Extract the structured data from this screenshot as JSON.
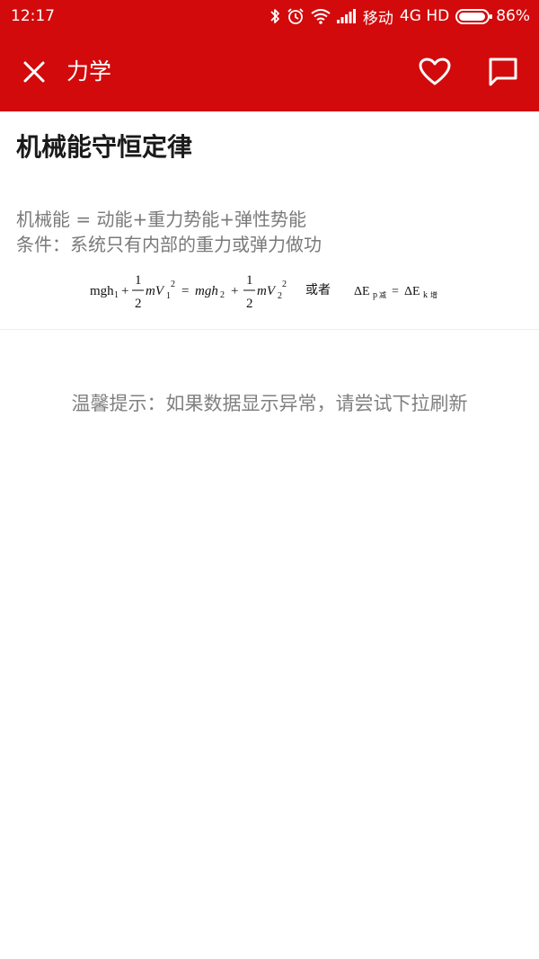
{
  "status_bar": {
    "time": "12:17",
    "carrier": "移动",
    "network": "4G HD",
    "battery": "86%",
    "battery_level": 0.86,
    "icons": [
      "bluetooth-icon",
      "alarm-icon",
      "wifi-icon",
      "signal-icon",
      "battery-icon"
    ]
  },
  "toolbar": {
    "title": "力学",
    "background_color": "#d20a0b",
    "icons": [
      "close-icon",
      "heart-icon",
      "comment-icon"
    ]
  },
  "article": {
    "title": "机械能守恒定律",
    "lines": [
      "机械能 = 动能+重力势能+弹性势能",
      "条件：系统只有内部的重力或弹力做功"
    ],
    "formula": {
      "lhs": "mgh",
      "lhs_sub": "1",
      "plus": "+",
      "half_num": "1",
      "half_den": "2",
      "mv": "mV",
      "sub1": "1",
      "sub2": "2",
      "sup": "2",
      "equals": "=",
      "rhs": "mgh",
      "rhs_sub": "2",
      "or": "或者",
      "delta_p": "ΔE",
      "p_sub": "p",
      "reduce": "减",
      "delta_k": "ΔE",
      "k_sub": "k",
      "increase": "增"
    }
  },
  "hint": "温馨提示：如果数据显示异常，请尝试下拉刷新"
}
